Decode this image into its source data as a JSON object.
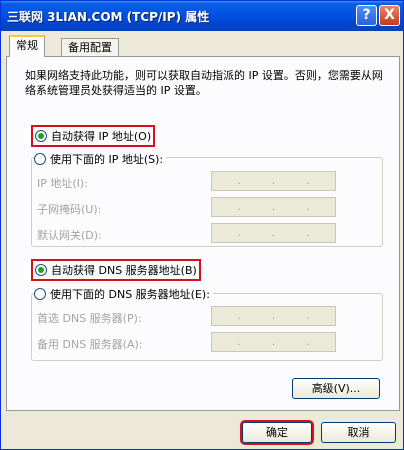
{
  "window": {
    "title": "三联网 3LIAN.COM (TCP/IP) 属性",
    "help_label": "?",
    "close_label": "X"
  },
  "tabs": [
    {
      "label": "常规",
      "active": true
    },
    {
      "label": "备用配置",
      "active": false
    }
  ],
  "description": "如果网络支持此功能，则可以获取自动指派的 IP 设置。否则，您需要从网络系统管理员处获得适当的 IP 设置。",
  "ip": {
    "auto_label": "自动获得 IP 地址(O)",
    "manual_label": "使用下面的 IP 地址(S):",
    "auto_selected": true,
    "fields": [
      {
        "label": "IP 地址(I):",
        "value": ""
      },
      {
        "label": "子网掩码(U):",
        "value": ""
      },
      {
        "label": "默认网关(D):",
        "value": ""
      }
    ]
  },
  "dns": {
    "auto_label": "自动获得 DNS 服务器地址(B)",
    "manual_label": "使用下面的 DNS 服务器地址(E):",
    "auto_selected": true,
    "fields": [
      {
        "label": "首选 DNS 服务器(P):",
        "value": ""
      },
      {
        "label": "备用 DNS 服务器(A):",
        "value": ""
      }
    ]
  },
  "buttons": {
    "advanced": "高级(V)...",
    "ok": "确定",
    "cancel": "取消"
  },
  "colors": {
    "highlight": "#d4101c",
    "titlebar": "#0055e5",
    "radio_dot": "#21a121"
  },
  "ip_dot": "."
}
